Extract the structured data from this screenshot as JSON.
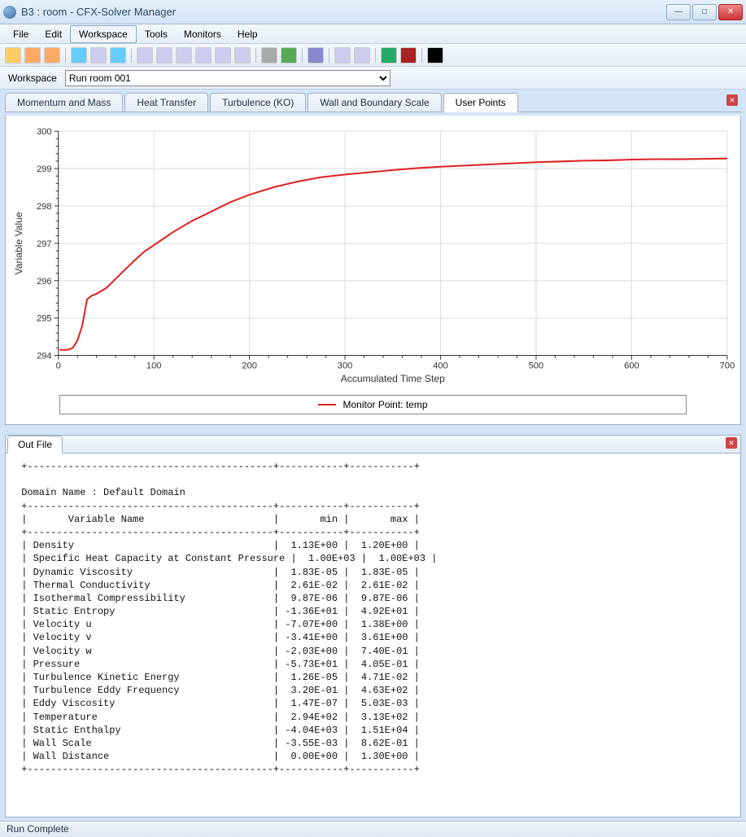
{
  "window": {
    "title": "B3 : room - CFX-Solver Manager"
  },
  "menu": {
    "items": [
      "File",
      "Edit",
      "Workspace",
      "Tools",
      "Monitors",
      "Help"
    ],
    "boxed_index": 2
  },
  "toolbar": {
    "icons": [
      "new-icon",
      "open-icon",
      "open-run-icon",
      "define-icon",
      "copy-icon",
      "edit-icon",
      "table-icon",
      "chart-icon",
      "grid-icon",
      "layout-icon",
      "text-icon",
      "stacked-icon",
      "stop-icon",
      "play-icon",
      "save-icon",
      "pencil-icon",
      "pen-icon",
      "rms-icon",
      "max-icon",
      "close-black-icon"
    ]
  },
  "workspace": {
    "label": "Workspace",
    "selected": "Run room 001"
  },
  "tabs": {
    "items": [
      "Momentum and Mass",
      "Heat Transfer",
      "Turbulence (KO)",
      "Wall and Boundary Scale",
      "User Points"
    ],
    "active_index": 4
  },
  "chart_data": {
    "type": "line",
    "title": "",
    "xlabel": "Accumulated Time Step",
    "ylabel": "Variable Value",
    "xlim": [
      0,
      700
    ],
    "ylim": [
      294,
      300
    ],
    "xticks": [
      0,
      100,
      200,
      300,
      400,
      500,
      600,
      700
    ],
    "yticks": [
      294,
      295,
      296,
      297,
      298,
      299,
      300
    ],
    "series": [
      {
        "name": "Monitor Point: temp",
        "color": "#d22",
        "x": [
          1,
          5,
          10,
          15,
          20,
          25,
          30,
          35,
          40,
          50,
          60,
          70,
          80,
          90,
          100,
          120,
          140,
          160,
          180,
          200,
          225,
          250,
          275,
          300,
          325,
          350,
          375,
          400,
          425,
          450,
          475,
          500,
          525,
          550,
          575,
          600,
          625,
          650,
          675,
          700
        ],
        "y": [
          294.15,
          294.15,
          294.15,
          294.2,
          294.4,
          294.8,
          295.5,
          295.6,
          295.65,
          295.8,
          296.05,
          296.3,
          296.55,
          296.78,
          296.95,
          297.3,
          297.6,
          297.85,
          298.1,
          298.3,
          298.5,
          298.65,
          298.77,
          298.84,
          298.9,
          298.96,
          299.01,
          299.05,
          299.08,
          299.11,
          299.14,
          299.17,
          299.19,
          299.21,
          299.22,
          299.24,
          299.25,
          299.25,
          299.26,
          299.27
        ]
      }
    ],
    "legend": "Monitor Point: temp"
  },
  "outfile": {
    "tab_label": "Out File",
    "domain_line": "Domain Name : Default Domain",
    "col_header": [
      "Variable Name",
      "min",
      "max"
    ],
    "rows": [
      {
        "name": "Density",
        "min": "1.13E+00",
        "max": "1.20E+00"
      },
      {
        "name": "Specific Heat Capacity at Constant Pressure",
        "min": "1.00E+03",
        "max": "1.00E+03"
      },
      {
        "name": "Dynamic Viscosity",
        "min": "1.83E-05",
        "max": "1.83E-05"
      },
      {
        "name": "Thermal Conductivity",
        "min": "2.61E-02",
        "max": "2.61E-02"
      },
      {
        "name": "Isothermal Compressibility",
        "min": "9.87E-06",
        "max": "9.87E-06"
      },
      {
        "name": "Static Entropy",
        "min": "-1.36E+01",
        "max": "4.92E+01"
      },
      {
        "name": "Velocity u",
        "min": "-7.07E+00",
        "max": "1.38E+00"
      },
      {
        "name": "Velocity v",
        "min": "-3.41E+00",
        "max": "3.61E+00"
      },
      {
        "name": "Velocity w",
        "min": "-2.03E+00",
        "max": "7.40E-01"
      },
      {
        "name": "Pressure",
        "min": "-5.73E+01",
        "max": "4.05E-01"
      },
      {
        "name": "Turbulence Kinetic Energy",
        "min": "1.26E-05",
        "max": "4.71E-02"
      },
      {
        "name": "Turbulence Eddy Frequency",
        "min": "3.20E-01",
        "max": "4.63E+02"
      },
      {
        "name": "Eddy Viscosity",
        "min": "1.47E-07",
        "max": "5.03E-03"
      },
      {
        "name": "Temperature",
        "min": "2.94E+02",
        "max": "3.13E+02"
      },
      {
        "name": "Static Enthalpy",
        "min": "-4.04E+03",
        "max": "1.51E+04"
      },
      {
        "name": "Wall Scale",
        "min": "-3.55E-03",
        "max": "8.62E-01"
      },
      {
        "name": "Wall Distance",
        "min": "0.00E+00",
        "max": "1.30E+00"
      }
    ]
  },
  "status": {
    "text": "Run Complete"
  }
}
